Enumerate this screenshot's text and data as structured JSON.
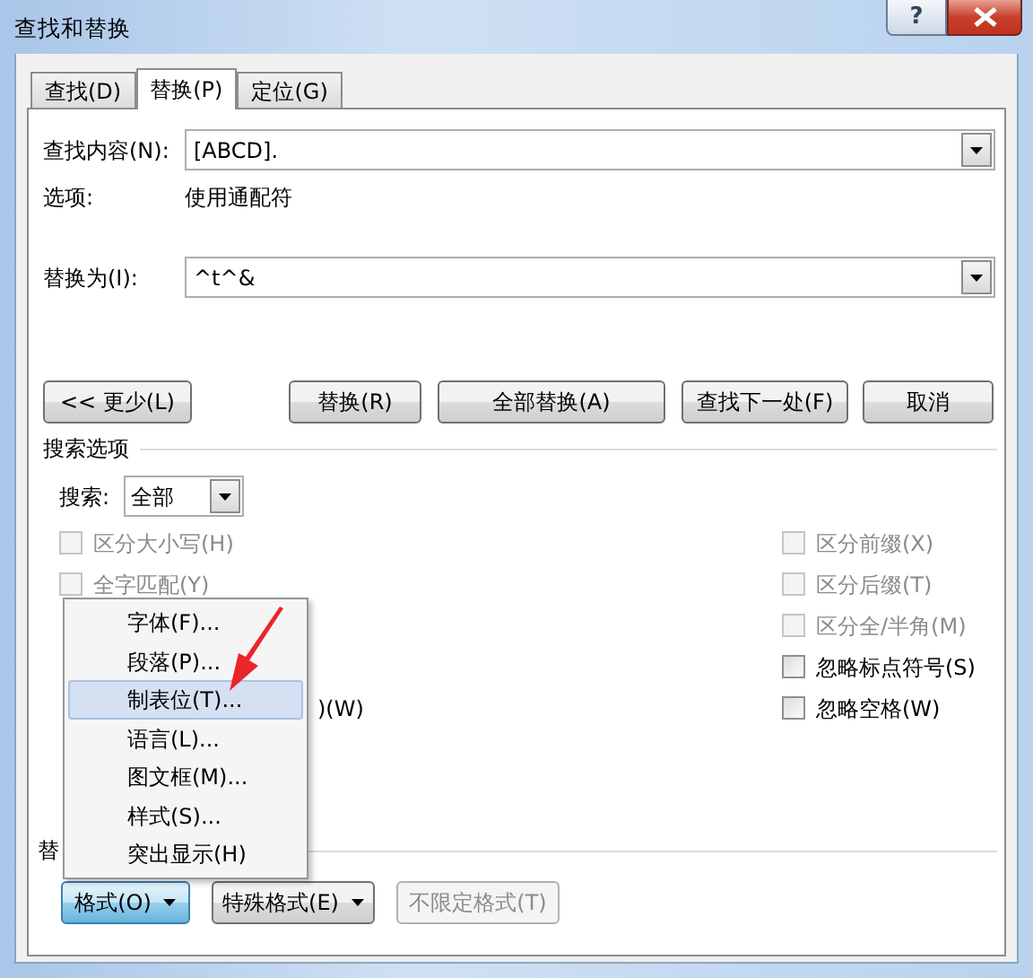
{
  "window": {
    "title": "查找和替换",
    "help": "?"
  },
  "tabs": [
    {
      "label": "查找(D)",
      "selected": false
    },
    {
      "label": "替换(P)",
      "selected": true
    },
    {
      "label": "定位(G)",
      "selected": false
    }
  ],
  "find": {
    "label": "查找内容(N):",
    "value": "[ABCD]."
  },
  "options": {
    "label": "选项:",
    "value": "使用通配符"
  },
  "replace": {
    "label": "替换为(I):",
    "value": "^t^&"
  },
  "buttons": [
    {
      "label": "<< 更少(L)"
    },
    {
      "label": "替换(R)"
    },
    {
      "label": "全部替换(A)"
    },
    {
      "label": "查找下一处(F)"
    },
    {
      "label": "取消"
    }
  ],
  "search_options": {
    "heading": "搜索选项",
    "search_label": "搜索:",
    "search_value": "全部",
    "left_options": [
      {
        "label": "区分大小写(H)",
        "checked": false,
        "disabled": true
      },
      {
        "label": "全字匹配(Y)",
        "checked": false,
        "disabled": true
      }
    ],
    "covered_fragment": ")(W)",
    "right_options": [
      {
        "label": "区分前缀(X)",
        "checked": false,
        "disabled": true
      },
      {
        "label": "区分后缀(T)",
        "checked": false,
        "disabled": true
      },
      {
        "label": "区分全/半角(M)",
        "checked": false,
        "disabled": true
      },
      {
        "label": "忽略标点符号(S)",
        "checked": false,
        "disabled": false
      },
      {
        "label": "忽略空格(W)",
        "checked": false,
        "disabled": false
      }
    ]
  },
  "replace_section": {
    "heading": "替"
  },
  "format_buttons": [
    {
      "label": "格式(O)",
      "kind": "menu",
      "pressed": true,
      "disabled": false
    },
    {
      "label": "特殊格式(E)",
      "kind": "menu",
      "pressed": false,
      "disabled": false
    },
    {
      "label": "不限定格式(T)",
      "kind": "plain",
      "pressed": false,
      "disabled": true
    }
  ],
  "format_menu": {
    "items": [
      {
        "label": "字体(F)...",
        "selected": false
      },
      {
        "label": "段落(P)...",
        "selected": false
      },
      {
        "label": "制表位(T)...",
        "selected": true
      },
      {
        "label": "语言(L)...",
        "selected": false
      },
      {
        "label": "图文框(M)...",
        "selected": false
      },
      {
        "label": "样式(S)...",
        "selected": false
      },
      {
        "label": "突出显示(H)",
        "selected": false
      }
    ]
  }
}
